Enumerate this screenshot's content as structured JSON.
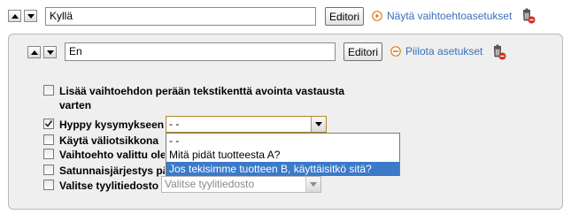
{
  "top_row": {
    "answer_value": "Kyllä",
    "edit_label": "Editori",
    "options_link": "Näytä vaihtoehtoasetukset"
  },
  "panel": {
    "answer_value": "En",
    "edit_label": "Editori",
    "hide_link": "Piilota asetukset",
    "checkboxes": [
      {
        "label_line1": "Lisää vaihtoehdon perään tekstikenttä avointa vastausta",
        "label_line2": "varten",
        "checked": false
      },
      {
        "label": "Hyppy kysymykseen",
        "checked": true
      },
      {
        "label": "Käytä väliotsikkona",
        "checked": false
      },
      {
        "label": "Vaihtoehto valittu ole",
        "checked": false
      },
      {
        "label": "Satunnaisjärjestys pä",
        "checked": false
      },
      {
        "label": "Valitse tyylitiedosto",
        "checked": false
      }
    ],
    "jump_select": {
      "value": "- -"
    },
    "jump_options": [
      "- -",
      "Mitä pidät tuotteesta A?",
      "Jos tekisimme tuotteen B, käyttäisitkö sitä?"
    ],
    "style_select": {
      "placeholder": "Valitse tyylitiedosto"
    }
  },
  "icons": {
    "up": "arrow-up-icon",
    "down": "arrow-down-icon",
    "delete": "trash-delete-icon",
    "show": "orange-circle-arrow-icon",
    "hide": "orange-circle-minus-icon"
  },
  "colors": {
    "link": "#3a70b8",
    "selection": "#3b79c9",
    "panel_bg": "#efefef"
  }
}
